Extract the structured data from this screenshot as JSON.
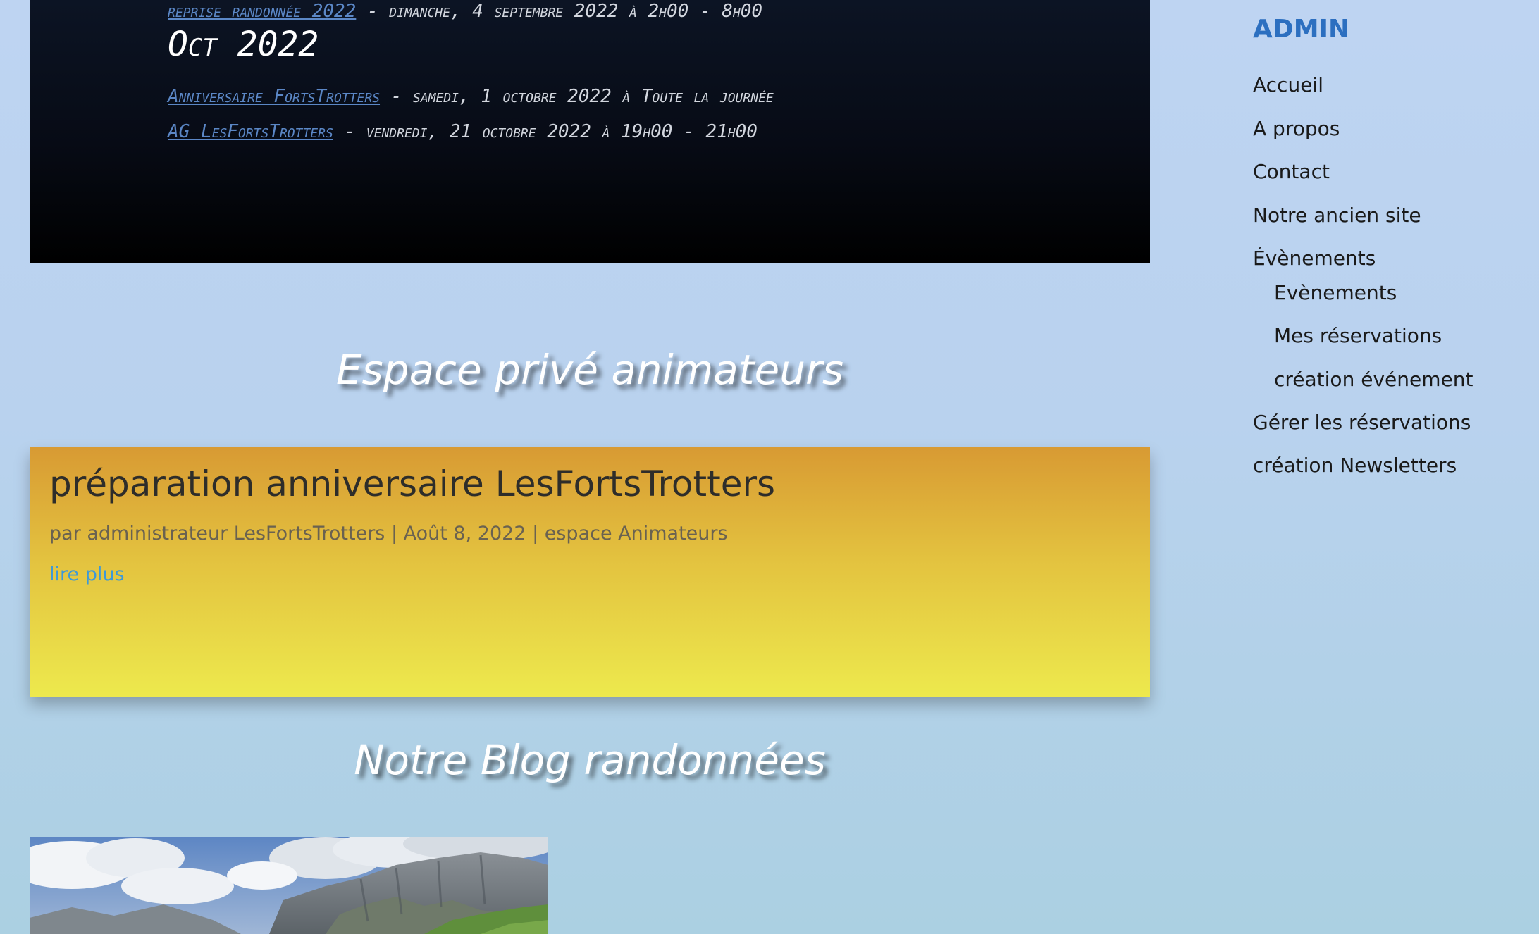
{
  "events": {
    "line1": {
      "title": "reprise randonnée 2022",
      "separator": " - ",
      "date": "dimanche, 4 septembre 2022 à 2h00 - 8h00"
    },
    "month_heading": "Oct 2022",
    "items": [
      {
        "title": "Anniversaire FortsTrotters",
        "separator": " - ",
        "date": "samedi, 1 octobre 2022 à Toute la journée"
      },
      {
        "title": "AG LesFortsTrotters",
        "separator": " - ",
        "date": "vendredi, 21 octobre 2022 à 19h00 - 21h00"
      }
    ]
  },
  "sections": {
    "private_heading": "Espace privé animateurs",
    "blog_heading": "Notre Blog randonnées"
  },
  "post": {
    "title": "préparation anniversaire LesFortsTrotters",
    "meta_prefix": "par ",
    "author": "administrateur LesFortsTrotters",
    "meta_sep1": " | ",
    "date": "Août 8, 2022",
    "meta_sep2": " | ",
    "category": "espace Animateurs",
    "read_more": "lire plus"
  },
  "sidebar": {
    "title": "ADMIN",
    "menu": [
      {
        "label": "Accueil"
      },
      {
        "label": "A propos"
      },
      {
        "label": "Contact"
      },
      {
        "label": "Notre ancien site"
      },
      {
        "label": "Évènements"
      },
      {
        "label": "Evènements"
      },
      {
        "label": "Mes réservations"
      },
      {
        "label": "création événement"
      },
      {
        "label": "Gérer les réservations"
      },
      {
        "label": "création Newsletters"
      }
    ]
  },
  "colors": {
    "page_background": "#bed4f2",
    "events_background": "#070b15",
    "event_link": "#5b87c6",
    "post_gradient_top": "#d89a33",
    "post_gradient_bottom": "#ede94d",
    "read_more": "#3d99d8",
    "sidebar_title": "#2c6fc0"
  }
}
